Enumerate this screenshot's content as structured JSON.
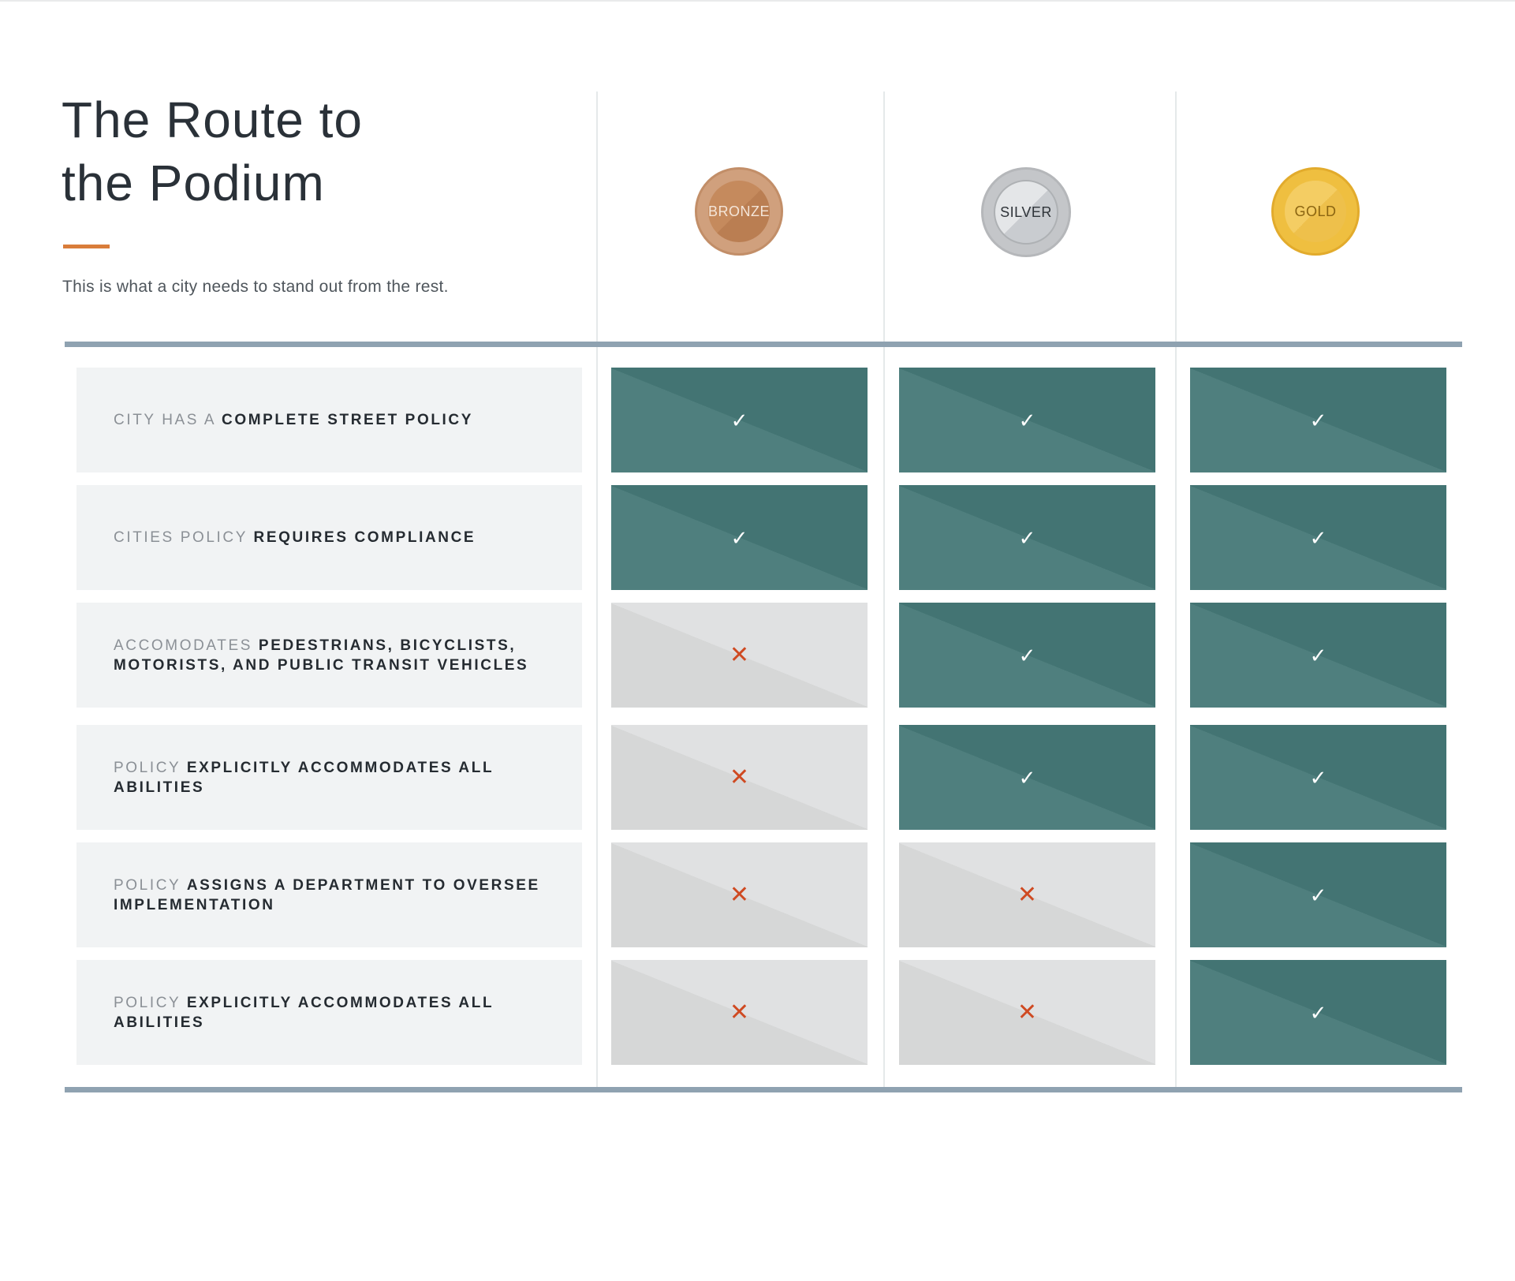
{
  "header": {
    "title": "The Route to\nthe Podium",
    "subtitle": "This is what a city needs to stand out from the rest."
  },
  "medals": [
    {
      "label": "BRONZE",
      "color": "#c58a5d"
    },
    {
      "label": "SILVER",
      "color": "#c4c6c9"
    },
    {
      "label": "GOLD",
      "color": "#efbf40"
    }
  ],
  "criteria": [
    {
      "muted": "CITY HAS A ",
      "strong": "COMPLETE STREET POLICY",
      "results": [
        true,
        true,
        true
      ]
    },
    {
      "muted": "CITIES POLICY ",
      "strong": "REQUIRES COMPLIANCE",
      "results": [
        true,
        true,
        true
      ]
    },
    {
      "muted": "ACCOMODATES ",
      "strong": "PEDESTRIANS, BICYCLISTS, MOTORISTS, AND PUBLIC TRANSIT VEHICLES",
      "results": [
        false,
        true,
        true
      ]
    },
    {
      "muted": "POLICY ",
      "strong": "EXPLICITLY ACCOMMODATES ALL ABILITIES",
      "results": [
        false,
        true,
        true
      ]
    },
    {
      "muted": "POLICY ",
      "strong": "ASSIGNS A DEPARTMENT TO OVERSEE IMPLEMENTATION",
      "results": [
        false,
        false,
        true
      ]
    },
    {
      "muted": "POLICY ",
      "strong": "EXPLICITLY ACCOMMODATES ALL ABILITIES",
      "results": [
        false,
        false,
        true
      ]
    }
  ],
  "marks": {
    "yes": "✓",
    "no": "✕"
  },
  "colors": {
    "accent": "#d97d3a",
    "met": "#4f7f7e",
    "unmet": "#d6d7d7",
    "cross": "#cf4a22",
    "rule": "#8fa2b1"
  }
}
